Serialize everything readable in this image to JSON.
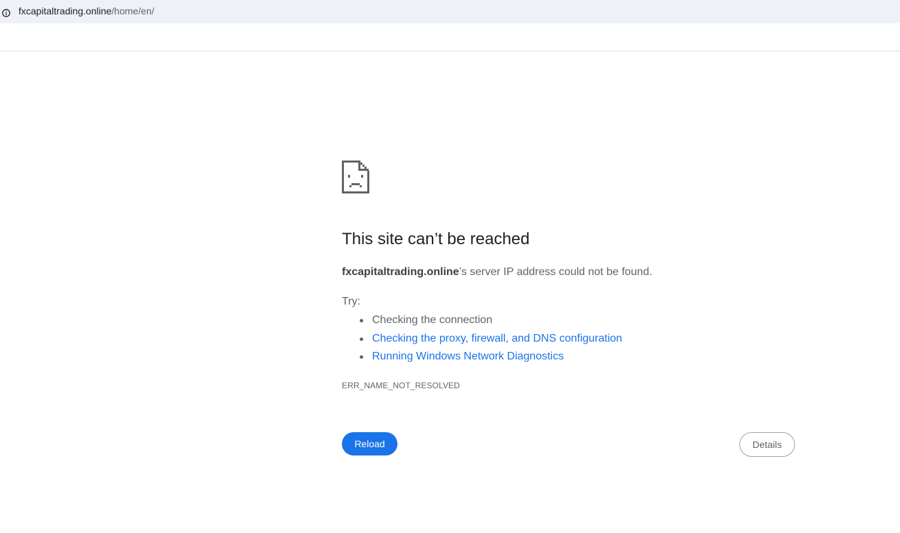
{
  "address_bar": {
    "icon": "info-icon",
    "url_host": "fxcapitaltrading.online",
    "url_path": "/home/en/"
  },
  "error": {
    "icon": "sad-document-icon",
    "title": "This site can’t be reached",
    "host": "fxcapitaltrading.online",
    "message": "’s server IP address could not be found.",
    "try_label": "Try:",
    "suggestions": [
      {
        "label": "Checking the connection",
        "link": false
      },
      {
        "label": "Checking the proxy, firewall, and DNS configuration",
        "link": true
      },
      {
        "label": "Running Windows Network Diagnostics",
        "link": true
      }
    ],
    "code": "ERR_NAME_NOT_RESOLVED"
  },
  "buttons": {
    "reload": "Reload",
    "details": "Details"
  },
  "colors": {
    "accent": "#1a73e8",
    "address_bar_bg": "#eef1f8",
    "text": "#5f6368",
    "title": "#202124"
  }
}
